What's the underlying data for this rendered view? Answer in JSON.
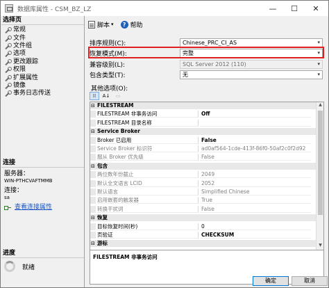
{
  "window": {
    "title": "数据库属性 - CSM_BZ_LZ",
    "minimize_glyph": "—",
    "maximize_glyph": "☐",
    "close_glyph": "✕"
  },
  "left": {
    "select_page_header": "选择页",
    "pages": [
      "常规",
      "文件",
      "文件组",
      "选项",
      "更改跟踪",
      "权限",
      "扩展属性",
      "镜像",
      "事务日志传送"
    ],
    "connection_header": "连接",
    "server_label": "服务器：",
    "server_value": "WIN-PTHCVAFTMMB",
    "connection_label": "连接：",
    "connection_value": "sa",
    "view_connection_link": "查看连接属性",
    "progress_header": "进度",
    "progress_status": "就绪"
  },
  "toolbar": {
    "script_label": "脚本",
    "caret": "▾",
    "help_label": "帮助",
    "help_glyph": "?"
  },
  "form": {
    "collation_label": "排序规则(C):",
    "collation_value": "Chinese_PRC_CI_AS",
    "recovery_label": "恢复模式(M):",
    "recovery_value": "完整",
    "compat_label": "兼容级别(L):",
    "compat_value": "SQL Server 2012 (110)",
    "containment_label": "包含类型(T):",
    "containment_value": "无",
    "other_options_label": "其他选项(O):",
    "dropdown_arrow": "▾"
  },
  "grid_tools": {
    "categorized": "⁞⁞",
    "alphabetical": "A↓",
    "pages": "▭"
  },
  "grid": {
    "expand_glyph": "⊟",
    "rows": [
      {
        "type": "cat",
        "name": "FILESTREAM"
      },
      {
        "type": "prop",
        "name": "FILESTREAM 非事务访问",
        "value": "Off",
        "bold_value": true
      },
      {
        "type": "prop",
        "name": "FILESTREAM 目录名称",
        "value": ""
      },
      {
        "type": "cat",
        "name": "Service Broker"
      },
      {
        "type": "prop",
        "name": "Broker 已启用",
        "value": "False",
        "bold_value": true
      },
      {
        "type": "prop",
        "name": "Service Broker 标识符",
        "value": "ad0af564-1cde-413f-86f0-50af2c0f2d92",
        "disabled": true
      },
      {
        "type": "prop",
        "name": "服从 Broker 优先级",
        "value": "False",
        "disabled": true
      },
      {
        "type": "cat",
        "name": "包含"
      },
      {
        "type": "prop",
        "name": "两位数年份截止",
        "value": "2049",
        "disabled": true
      },
      {
        "type": "prop",
        "name": "默认全文语言 LCID",
        "value": "2052",
        "disabled": true
      },
      {
        "type": "prop",
        "name": "默认语言",
        "value": "Simplified Chinese",
        "disabled": true
      },
      {
        "type": "prop",
        "name": "启用嵌套的触发器",
        "value": "True",
        "disabled": true
      },
      {
        "type": "prop",
        "name": "转换干扰词",
        "value": "False",
        "disabled": true
      },
      {
        "type": "cat",
        "name": "恢复"
      },
      {
        "type": "prop",
        "name": "目标恢复时间(秒)",
        "value": "0"
      },
      {
        "type": "prop",
        "name": "页验证",
        "value": "CHECKSUM",
        "bold_value": true
      },
      {
        "type": "cat",
        "name": "游标"
      }
    ],
    "description": "FILESTREAM 非事务访问",
    "scroll_up": "▲",
    "scroll_down": "▼"
  },
  "footer": {
    "ok_label": "确定",
    "cancel_label": "取消"
  },
  "colors": {
    "highlight_border": "#e02020",
    "link": "#1a56c8",
    "category_bg": "#e8e8e8"
  }
}
